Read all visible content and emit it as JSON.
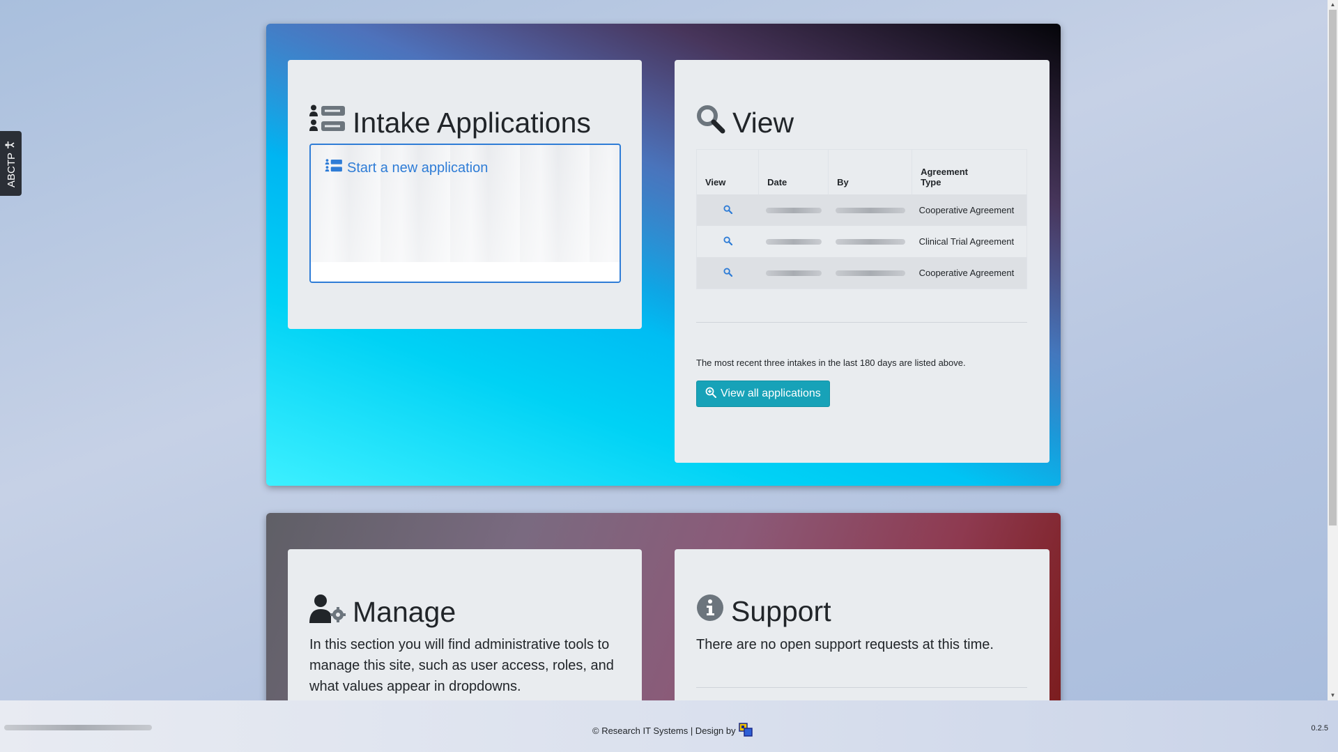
{
  "side_tab": {
    "label": "ABCTP"
  },
  "intake": {
    "title": "Intake Applications",
    "start_link": "Start a new application"
  },
  "view": {
    "title": "View",
    "columns": [
      "View",
      "Date",
      "By",
      "Agreement Type"
    ],
    "rows": [
      {
        "agreement_type": "Cooperative Agreement"
      },
      {
        "agreement_type": "Clinical Trial Agreement"
      },
      {
        "agreement_type": "Cooperative Agreement"
      }
    ],
    "note": "The most recent three intakes in the last 180 days are listed above.",
    "view_all_label": "View all applications"
  },
  "manage": {
    "title": "Manage",
    "text": "In this section you will find administrative tools to manage this site, such as user access, roles, and what values appear in dropdowns."
  },
  "support": {
    "title": "Support",
    "text": "There are no open support requests at this time."
  },
  "footer": {
    "credits": "© Research IT Systems | Design by",
    "version": "0.2.5"
  },
  "colors": {
    "link_blue": "#2e7cd6",
    "info_button": "#17a2b8",
    "card_bg": "#e9ecef"
  }
}
